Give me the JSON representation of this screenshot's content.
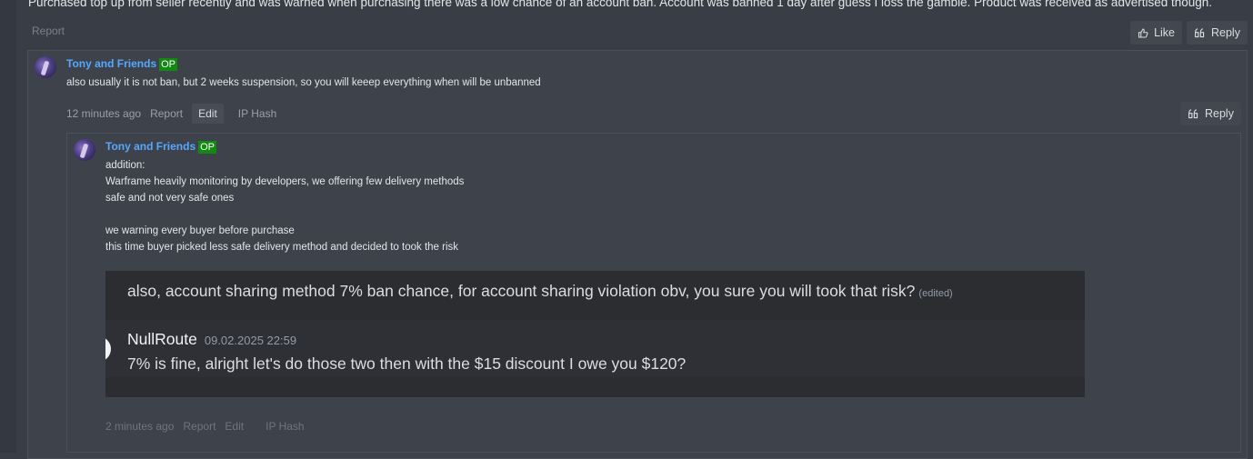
{
  "top_post": {
    "text": "Purchased top up from seller recently and was warned when purchasing there was a low chance of an account ban. Account was banned 1 day after guess I loss the gamble. Product was received as advertised though.",
    "report_label": "Report",
    "like_label": "Like",
    "reply_label": "Reply"
  },
  "comment1": {
    "username": "Tony and Friends",
    "badge": "OP",
    "text": "also usually it is not ban, but 2 weeks suspension, so you will keeep everything when will be unbanned",
    "time": "12 minutes ago",
    "report_label": "Report",
    "edit_label": "Edit",
    "iphash_label": "IP Hash",
    "reply_label": "Reply"
  },
  "comment2": {
    "username": "Tony and Friends",
    "badge": "OP",
    "lines": [
      "addition:",
      "Warframe heavily monitoring by developers, we offering few delivery methods",
      "safe and not very safe ones",
      "",
      "we warning every buyer before purchase",
      "this time buyer picked less safe delivery method and decided to took the risk"
    ],
    "embed": {
      "top_text": "also, account sharing method 7% ban chance, for account sharing violation obv, you sure you will took that risk?",
      "edited": "(edited)",
      "author": "NullRoute",
      "timestamp": "09.02.2025 22:59",
      "message": "7% is fine, alright let's do those two then with the $15 discount I owe you $120?"
    },
    "time": "2 minutes ago",
    "report_label": "Report",
    "edit_label": "Edit",
    "iphash_label": "IP Hash"
  }
}
